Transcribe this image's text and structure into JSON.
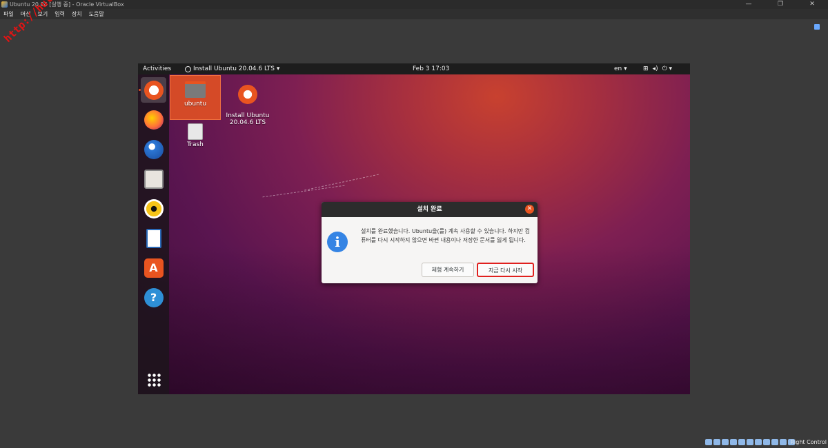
{
  "vbox": {
    "title": "Ubuntu 20.04 [실행 중] - Oracle VirtualBox",
    "menu": [
      "파일",
      "머신",
      "보기",
      "입력",
      "장치",
      "도움말"
    ],
    "window_buttons": [
      "—",
      "❐",
      "✕"
    ],
    "status_right": "Right Control"
  },
  "watermark": "http://hull.kr",
  "guest": {
    "topbar": {
      "activities": "Activities",
      "app_menu": "Install Ubuntu 20.04.6 LTS ▾",
      "clock": "Feb 3  17:03",
      "lang": "en ▾",
      "tray": [
        "⊞",
        "◂)",
        "⏻ ▾"
      ]
    },
    "dock": [
      "ubuntu-installer-icon",
      "firefox-icon",
      "thunderbird-icon",
      "files-icon",
      "rhythmbox-icon",
      "libreoffice-writer-icon",
      "software-center-icon",
      "help-icon",
      "show-apps-icon"
    ],
    "desktop": {
      "home_label": "ubuntu",
      "installer_label": "Install Ubuntu\n20.04.6 LTS",
      "trash_label": "Trash"
    },
    "dialog": {
      "title": "설치 완료",
      "message": "설치를 완료했습니다. Ubuntu을(를) 계속 사용할 수 있습니다. 하지만 컴퓨터를 다시 시작하지 않으면 바뀐 내용이나 저장한 문서를 잃게 됩니다.",
      "continue_label": "체험 계속하기",
      "restart_label": "지금 다시 시작"
    }
  }
}
